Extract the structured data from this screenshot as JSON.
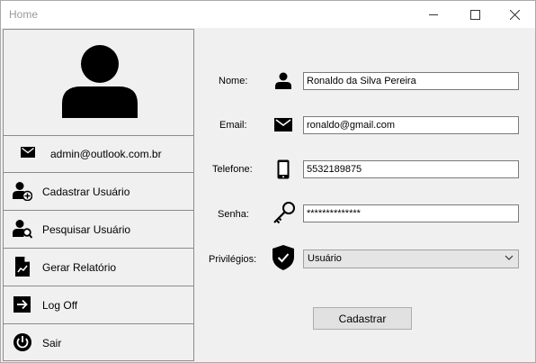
{
  "window": {
    "title": "Home"
  },
  "sidebar": {
    "email": "admin@outlook.com.br",
    "items": [
      {
        "label": "Cadastrar Usuário",
        "icon": "add-user-icon"
      },
      {
        "label": "Pesquisar Usuário",
        "icon": "search-user-icon"
      },
      {
        "label": "Gerar Relatório",
        "icon": "report-icon"
      },
      {
        "label": "Log Off",
        "icon": "logoff-icon"
      },
      {
        "label": "Sair",
        "icon": "power-icon"
      }
    ]
  },
  "form": {
    "nome_label": "Nome:",
    "nome_value": "Ronaldo da Silva Pereira",
    "email_label": "Email:",
    "email_value": "ronaldo@gmail.com",
    "telefone_label": "Telefone:",
    "telefone_value": "5532189875",
    "senha_label": "Senha:",
    "senha_value": "**************",
    "privilegios_label": "Privilégios:",
    "privilegios_value": "Usuário",
    "submit_label": "Cadastrar"
  }
}
